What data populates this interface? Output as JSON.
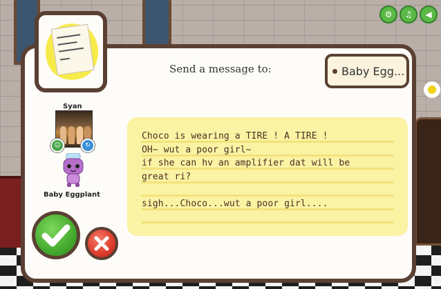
{
  "scene": {
    "top_buttons": [
      {
        "name": "settings-icon",
        "glyph": "⚙"
      },
      {
        "name": "music-icon",
        "glyph": "♫"
      },
      {
        "name": "sound-icon",
        "glyph": "◀"
      }
    ]
  },
  "dialog": {
    "prompt_label": "Send a message to:",
    "recipient_tag": "Baby Egg..."
  },
  "sender": {
    "name": "Syan"
  },
  "recipient": {
    "name": "Baby Eggplant"
  },
  "message": {
    "text": "Choco is wearing a TIRE ! A TIRE !\nOH~ wut a poor girl~\nif she can hv an amplifier dat will be\ngreat ri?\n\nsigh...Choco...wut a poor girl...."
  },
  "colors": {
    "confirm": "#44ab2f",
    "cancel": "#dd3b2b",
    "frame": "#5a4033",
    "note_paper": "#fbf3a4"
  }
}
